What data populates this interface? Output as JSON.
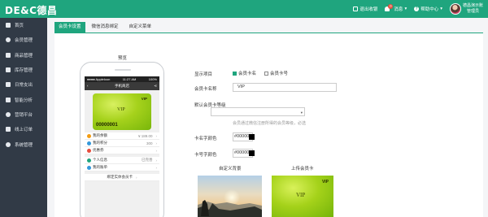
{
  "brand": {
    "logo": "DE&C德昌"
  },
  "topbar": {
    "items": [
      {
        "label": "退出收银",
        "icon": "cashier-icon"
      },
      {
        "label": "消息",
        "badge": "0",
        "icon": "bell-icon"
      },
      {
        "label": "帮助中心",
        "icon": "help-icon"
      }
    ],
    "user": {
      "name": "德昌演示账",
      "role": "管理员"
    }
  },
  "sidebar": {
    "items": [
      {
        "label": "首页",
        "icon": "home-icon"
      },
      {
        "label": "会员管理",
        "icon": "user-icon"
      },
      {
        "label": "商品管理",
        "icon": "goods-icon"
      },
      {
        "label": "库存管理",
        "icon": "inventory-icon"
      },
      {
        "label": "日常支出",
        "icon": "expense-icon"
      },
      {
        "label": "智能分析",
        "icon": "analysis-icon"
      },
      {
        "label": "营销平台",
        "icon": "marketing-icon"
      },
      {
        "label": "线上订单",
        "icon": "order-icon"
      },
      {
        "label": "系统管理",
        "icon": "settings-icon"
      }
    ]
  },
  "tabs": [
    {
      "label": "会员卡设置",
      "active": true
    },
    {
      "label": "微信消息绑定",
      "active": false
    },
    {
      "label": "自定义菜单",
      "active": false
    }
  ],
  "preview": {
    "label": "预览",
    "status_left": "●●●● Appleloon",
    "status_time": "11:27 AM",
    "status_right": "100%",
    "nav_title": "手机商店",
    "card_vip": "VIP",
    "card_number": "00000001",
    "rows": [
      {
        "label": "我的余额",
        "value": "¥ 189.00",
        "color": "#f39c12"
      },
      {
        "label": "我的积分",
        "value": "300",
        "color": "#3498db"
      },
      {
        "label": "优惠券",
        "value": "",
        "color": "#e74c3c"
      }
    ],
    "rows2": [
      {
        "label": "个人信息",
        "value": "已完善",
        "color": "#1fa57e"
      },
      {
        "label": "我的账单",
        "value": "",
        "color": "#3498db"
      }
    ],
    "bottom_row": "绑定实体会员卡"
  },
  "form": {
    "display_label": "显示项目",
    "opt_card_name": "会员卡名",
    "opt_card_number": "会员卡号",
    "card_name_label": "会员卡名称",
    "card_name_value": "VIP",
    "default_level_label": "默认会员卡等级",
    "default_level_value": "",
    "hint": "会员通过微信注册所得的会员等级，必选",
    "name_color_label": "卡名字颜色",
    "name_color_value": "#000000",
    "number_color_label": "卡号字颜色",
    "number_color_value": "#000000",
    "bg_label": "自定义背景",
    "upload_label": "上传会员卡",
    "upload_card_vip": "VIP"
  },
  "colors": {
    "accent": "#1fa57e",
    "sidebar": "#313a46"
  }
}
